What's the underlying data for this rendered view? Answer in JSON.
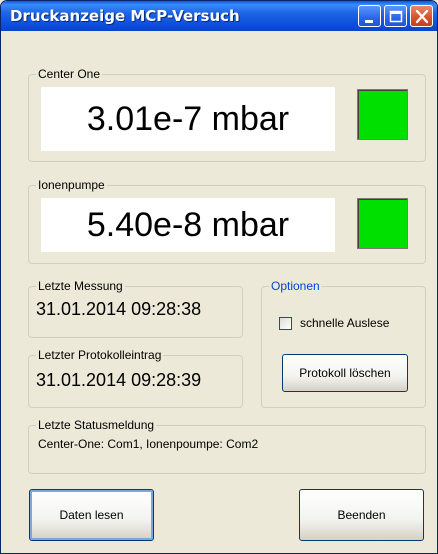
{
  "window": {
    "title": "Druckanzeige MCP-Versuch"
  },
  "center_one": {
    "label": "Center One",
    "value": "3.01e-7 mbar",
    "status_color": "#00E000"
  },
  "ionenpumpe": {
    "label": "Ionenpumpe",
    "value": "5.40e-8 mbar",
    "status_color": "#00E000"
  },
  "letzte_messung": {
    "label": "Letzte Messung",
    "value": "31.01.2014 09:28:38"
  },
  "letzter_protokolleintrag": {
    "label": "Letzter Protokolleintrag",
    "value": "31.01.2014 09:28:39"
  },
  "optionen": {
    "label": "Optionen",
    "checkbox_label": "schnelle Auslese",
    "checkbox_checked": false,
    "clear_log_button": "Protokoll löschen"
  },
  "status": {
    "label": "Letzte Statusmeldung",
    "message": "Center-One: Com1, Ionenpoumpe: Com2"
  },
  "buttons": {
    "read_data": "Daten lesen",
    "quit": "Beenden"
  },
  "colors": {
    "title_bar": "#0B4FD9",
    "indicator_ok": "#00E000",
    "group_label_accent": "#0046D5"
  }
}
